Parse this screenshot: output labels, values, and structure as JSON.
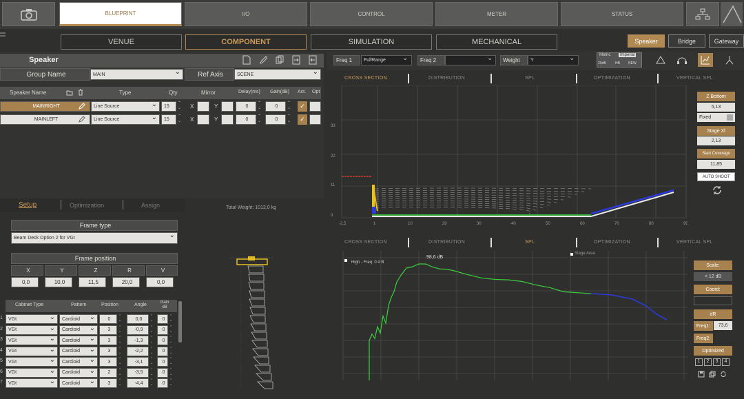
{
  "top_tabs": {
    "blueprint": "BLUEPRINT",
    "io": "I/O",
    "control": "CONTROL",
    "meter": "METER",
    "status": "STATUS"
  },
  "sub_tabs": {
    "venue": "VENUE",
    "component": "COMPONENT",
    "simulation": "SIMULATION",
    "mechanical": "MECHANICAL"
  },
  "right_tabs": {
    "speaker": "Speaker",
    "bridge": "Bridge",
    "gateway": "Gateway"
  },
  "speaker_panel": {
    "title": "Speaker",
    "group_name_label": "Group Name",
    "group_name_value": "MAIN",
    "ref_axis_label": "Ref Axis",
    "ref_axis_value": "SCENE",
    "columns": [
      "Speaker Name",
      "Type",
      "Qty",
      "Mirror",
      "Delay(ms)",
      "Gain(dB)",
      "Act.",
      "Opt"
    ],
    "rows": [
      {
        "name": "MAINRIGHT",
        "type": "Line Source",
        "qty": "15",
        "x": "X",
        "y": "Y",
        "delay": "0",
        "gain": "0"
      },
      {
        "name": "MAINLEFT",
        "type": "Line Source",
        "qty": "15",
        "x": "X",
        "y": "Y",
        "delay": "0",
        "gain": "0"
      }
    ]
  },
  "setup": {
    "tabs": {
      "setup": "Setup",
      "optimization": "Optimization",
      "assign": "Assign"
    },
    "frame_type_label": "Frame type",
    "frame_type_value": "Beam Deck Option 2 for VGt",
    "frame_position_label": "Frame position",
    "pos_headers": [
      "X",
      "Y",
      "Z",
      "R",
      "V"
    ],
    "pos_values": [
      "0,0",
      "10,0",
      "11,5",
      "20,0",
      "0,0"
    ],
    "cab_headers": [
      "Cabinet Type",
      "Pattern",
      "Position",
      "Angle",
      "Gain dB"
    ],
    "cab_rows": [
      {
        "type": "VGt",
        "pattern": "Cardioid",
        "pos": "0",
        "angle": "0,0",
        "gain": "0"
      },
      {
        "type": "VGt",
        "pattern": "Cardioid",
        "pos": "3",
        "angle": "-0,9",
        "gain": "0"
      },
      {
        "type": "VGt",
        "pattern": "Cardioid",
        "pos": "3",
        "angle": "-1,3",
        "gain": "0"
      },
      {
        "type": "VGt",
        "pattern": "Cardioid",
        "pos": "3",
        "angle": "-2,2",
        "gain": "0"
      },
      {
        "type": "VGt",
        "pattern": "Cardioid",
        "pos": "3",
        "angle": "-3,1",
        "gain": "0"
      },
      {
        "type": "VGt",
        "pattern": "Cardioid",
        "pos": "2",
        "angle": "-3,5",
        "gain": "0"
      },
      {
        "type": "VGt",
        "pattern": "Cardioid",
        "pos": "3",
        "angle": "-4,4",
        "gain": "0"
      }
    ],
    "row_numbers": [
      "1",
      "2",
      "3",
      "4",
      "5",
      "6",
      "7"
    ]
  },
  "preview": {
    "weight_label": "Total Weight: 1012,0 kg"
  },
  "sim_controls": {
    "freq1_label": "Freq 1",
    "freq1_value": "FullRange",
    "freq2_label": "Freq 2",
    "weight_label": "Weight",
    "weight_value": "Y",
    "metric": "Metric",
    "imperial": "Imperial",
    "b1": "20dB",
    "b2": "HB",
    "b3": "NEW"
  },
  "plot_tabs": [
    "CROSS SECTION",
    "DISTRIBUTION",
    "SPL",
    "OPTIMIZATION",
    "VERTICAL SPL"
  ],
  "cross_section": {
    "y_ticks": [
      "33",
      "22",
      "11",
      "0"
    ],
    "x_ticks": [
      "-2,5",
      "1",
      "10",
      "20",
      "30",
      "40",
      "50",
      "60",
      "70",
      "80",
      "90"
    ]
  },
  "spl": {
    "peak_label": "98,6 dB",
    "note": "High - Freq: 0 d B",
    "legend": "Stage Area"
  },
  "cs_side": {
    "z_bottom": "Z Bottom",
    "z_bottom_value": "5,13",
    "fixed": "Fixed",
    "stage_x": "Stage Xl",
    "stage_x_value": "2,13",
    "start_coverage": "Start Coverage",
    "start_coverage_value": "11,85",
    "auto_shoot": "AUTO SHOOT"
  },
  "spl_side": {
    "scale": "Scale:",
    "scale_value": "< 12 dB",
    "coord": "Coord:",
    "dr": "dR",
    "freq1": "Freq1:",
    "freq1_value": "73,6",
    "freq2": "Freq2:",
    "optimized": "Optimized",
    "nums": [
      "1",
      "2",
      "3",
      "4"
    ]
  },
  "colors": {
    "accent": "#b08a52",
    "green": "#3ccf3c",
    "blue": "#2b3ad8",
    "red": "#d23a2a"
  }
}
